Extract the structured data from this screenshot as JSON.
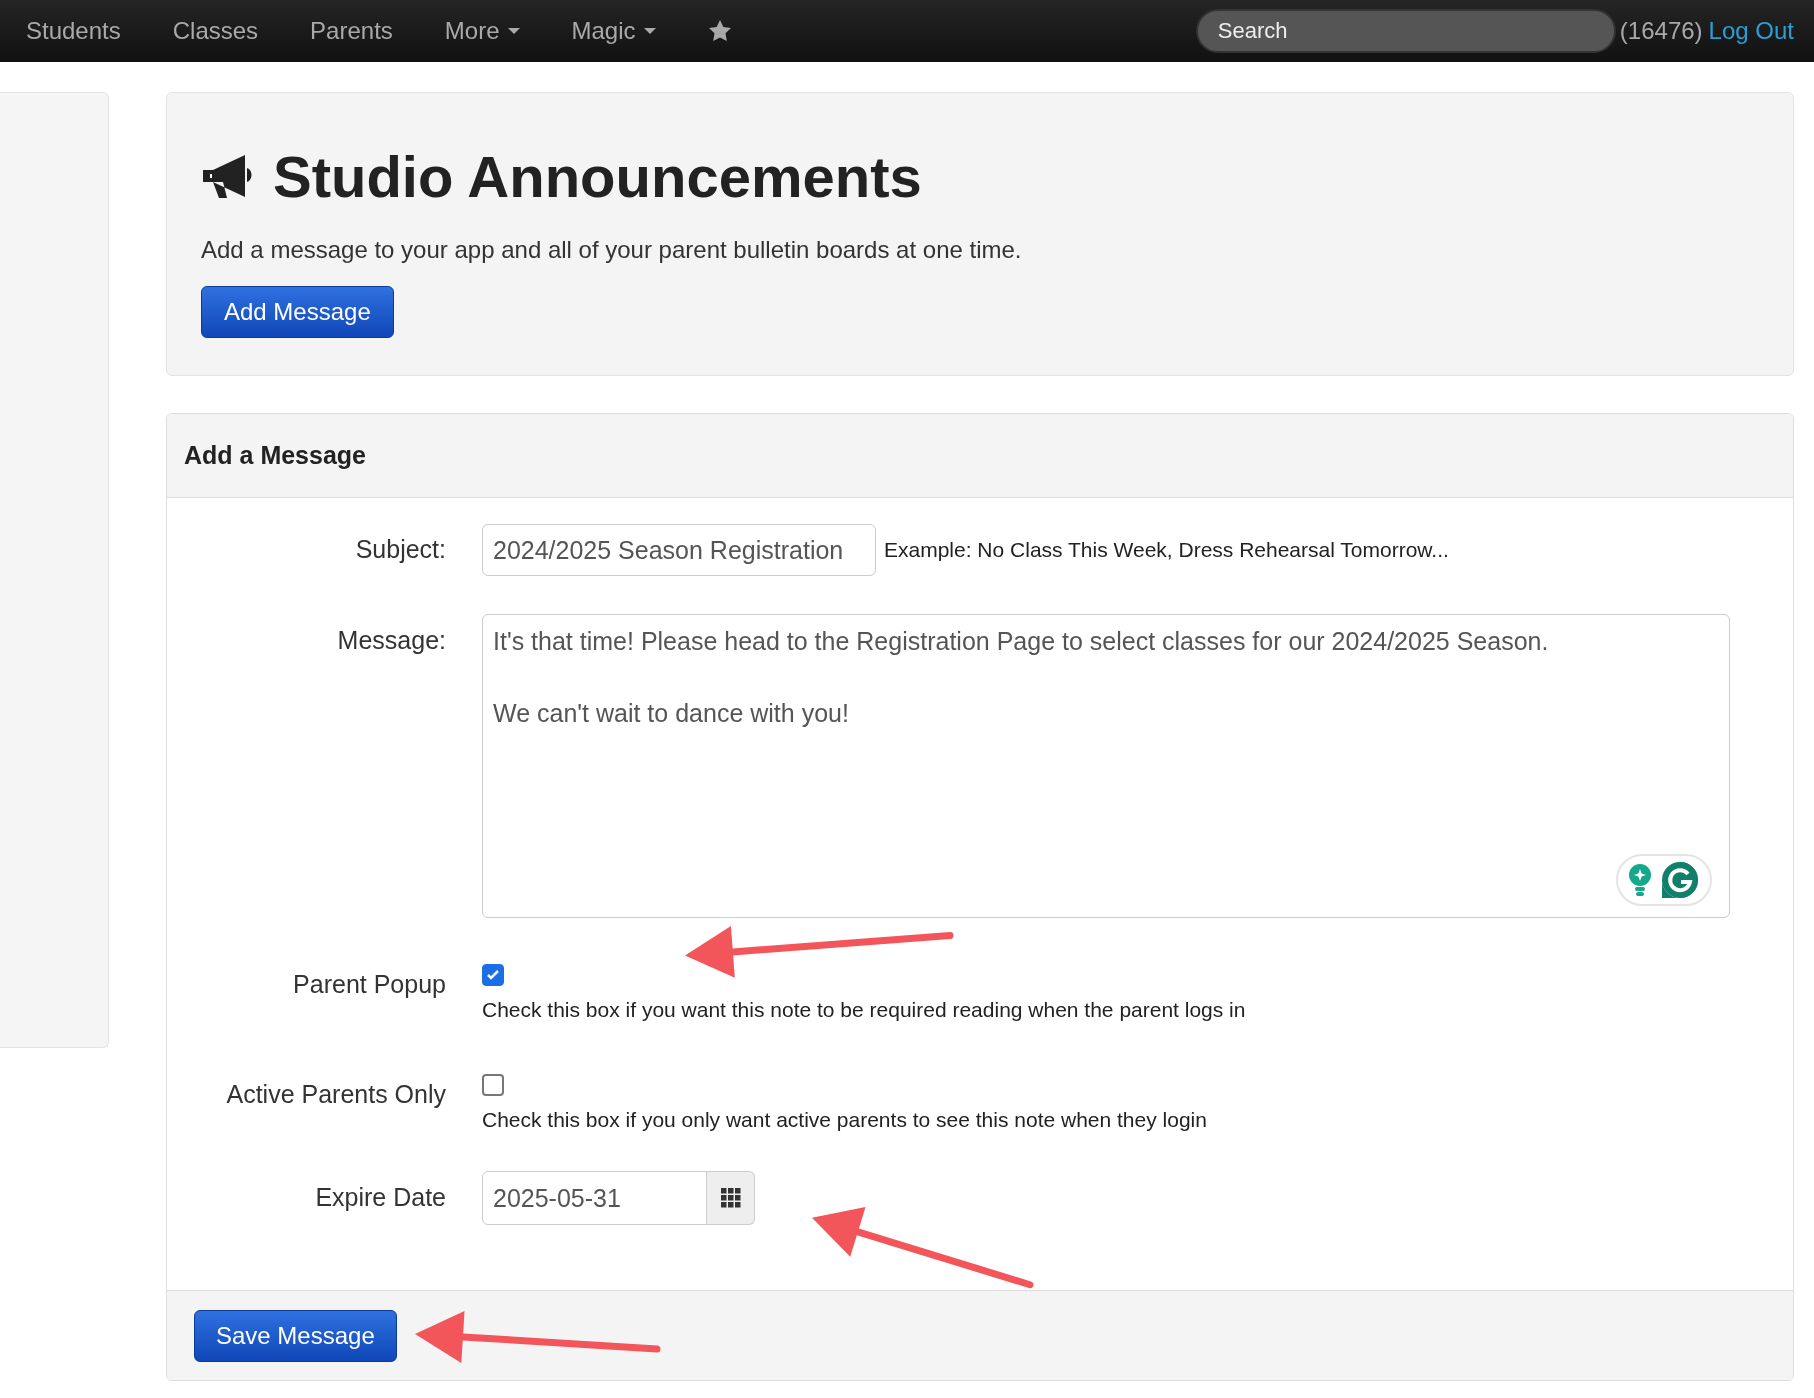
{
  "nav": {
    "items": [
      {
        "label": "Students",
        "dropdown": false
      },
      {
        "label": "Classes",
        "dropdown": false
      },
      {
        "label": "Parents",
        "dropdown": false
      },
      {
        "label": "More",
        "dropdown": true
      },
      {
        "label": "Magic",
        "dropdown": true
      }
    ],
    "search": {
      "placeholder": "Search"
    },
    "account_id": "(16476)",
    "logout": "Log Out"
  },
  "header": {
    "title": "Studio Announcements",
    "subtitle": "Add a message to your app and all of your parent bulletin boards at one time.",
    "button": "Add Message"
  },
  "form": {
    "title": "Add a Message",
    "subject": {
      "label": "Subject:",
      "value": "2024/2025 Season Registration",
      "hint": "Example: No Class This Week, Dress Rehearsal Tomorrow..."
    },
    "message": {
      "label": "Message:",
      "value": "It's that time! Please head to the Registration Page to select classes for our 2024/2025 Season.\n\nWe can't wait to dance with you!"
    },
    "checkboxes": [
      {
        "label": "Parent Popup",
        "checked": true,
        "help": "Check this box if you want this note to be required reading when the parent logs in"
      },
      {
        "label": "Active Parents Only",
        "checked": false,
        "help": "Check this box if you only want active parents to see this note when they login"
      }
    ],
    "expire": {
      "label": "Expire Date",
      "value": "2025-05-31"
    },
    "save": "Save Message"
  }
}
